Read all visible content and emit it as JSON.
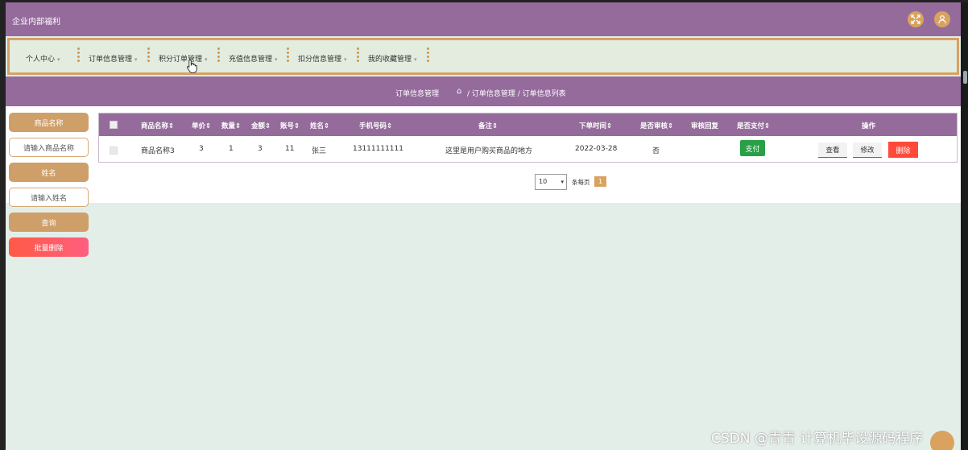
{
  "app": {
    "title": "企业内部福利"
  },
  "top_icons": [
    "fullscreen-icon",
    "user-icon"
  ],
  "nav": {
    "items": [
      {
        "label": "个人中心"
      },
      {
        "label": "订单信息管理"
      },
      {
        "label": "积分订单管理"
      },
      {
        "label": "充值信息管理"
      },
      {
        "label": "扣分信息管理"
      },
      {
        "label": "我的收藏管理"
      }
    ],
    "caret": "▾"
  },
  "breadcrumb": {
    "title": "订单信息管理",
    "home_icon": "⌂",
    "path": " / 订单信息管理 / 订单信息列表"
  },
  "search": {
    "product_label": "商品名称",
    "product_placeholder": "请输入商品名称",
    "name_label": "姓名",
    "name_placeholder": "请输入姓名",
    "query_label": "查询",
    "bulk_delete_label": "批量删除"
  },
  "table": {
    "headers": [
      "商品名称⇕",
      "单价⇕",
      "数量⇕",
      "金额⇕",
      "账号⇕",
      "姓名⇕",
      "手机号码⇕",
      "备注⇕",
      "下单时间⇕",
      "是否审核⇕",
      "审核回复",
      "是否支付⇕",
      "操作"
    ],
    "rows": [
      {
        "product": "商品名称3",
        "price": "3",
        "qty": "1",
        "amount": "3",
        "account": "11",
        "name": "张三",
        "phone": "13111111111",
        "note": "这里是用户购买商品的地方",
        "order_time": "2022-03-28",
        "reviewed": "否",
        "review_reply": "",
        "pay_label": "支付",
        "view_label": "查看",
        "edit_label": "修改",
        "delete_label": "删除"
      }
    ]
  },
  "pagination": {
    "page_size": "10",
    "per_page_label": "条每页",
    "current_page": "1"
  },
  "watermark": "CSDN @青青  计算机毕设源码程序",
  "colors": {
    "header_bg": "#956b9c",
    "accent": "#d9a35f",
    "page_bg": "#e4eee9",
    "pay": "#27a046",
    "delete": "#ff4a3a"
  }
}
